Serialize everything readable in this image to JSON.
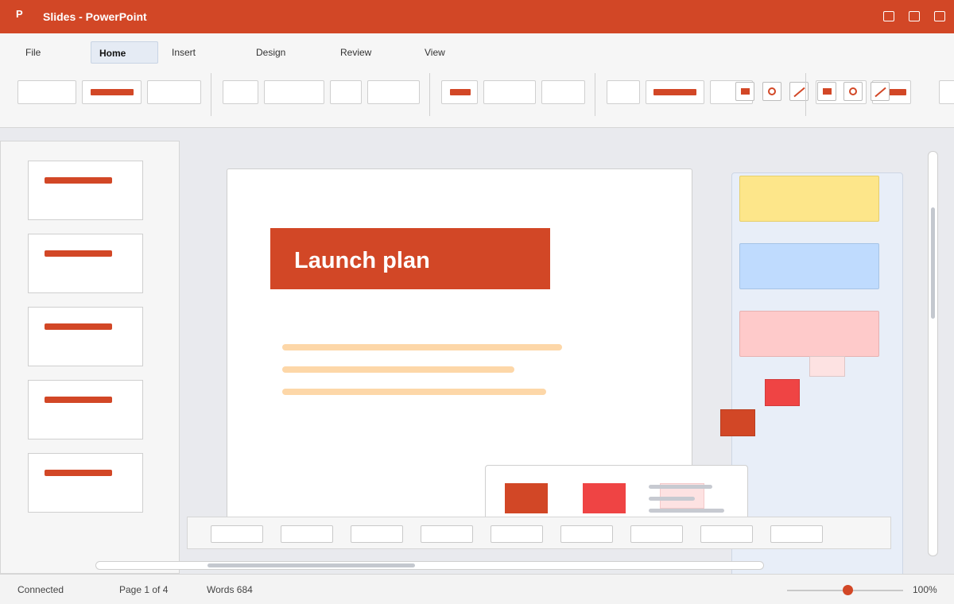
{
  "app": {
    "icon_letter": "P",
    "title": "Slides - PowerPoint"
  },
  "window_controls": [
    "minimize-icon",
    "maximize-icon",
    "close-icon"
  ],
  "tabs": [
    {
      "label": "File",
      "active": false
    },
    {
      "label": "Home",
      "active": true
    },
    {
      "label": "Insert",
      "active": false
    },
    {
      "label": "Design",
      "active": false
    },
    {
      "label": "Review",
      "active": false
    },
    {
      "label": "View",
      "active": false
    }
  ],
  "slide": {
    "title": "Launch plan"
  },
  "thumbnails_count": 5,
  "design_swatches": [
    "#fde68a",
    "#bfdbfe",
    "#fecaca"
  ],
  "status": {
    "connection": "Connected",
    "page": "Page 1 of 4",
    "words": "Words 684",
    "zoom": "100%"
  },
  "colors": {
    "accent": "#d24726",
    "accent_red": "#ef4444"
  }
}
